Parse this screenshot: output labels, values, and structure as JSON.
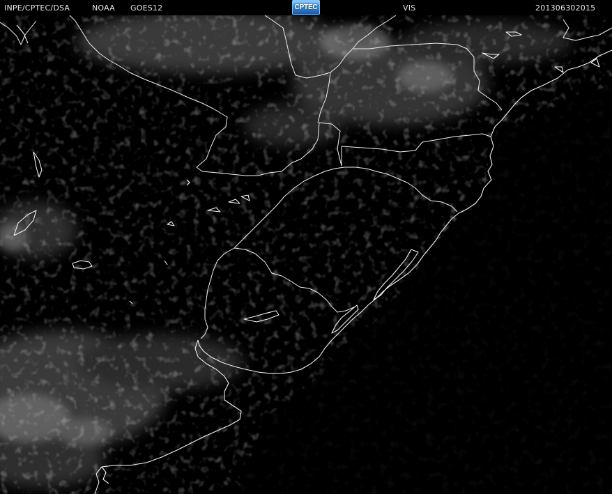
{
  "header": {
    "agency": "INPE/CPTEC/DSA",
    "source": "NOAA",
    "satellite": "GOES12",
    "logo_text": "CPTEC",
    "band": "VIS",
    "timestamp": "201306302015"
  },
  "colors": {
    "background": "#000000",
    "linework": "#f0f0f0",
    "clouds": "#8a8a8a",
    "logo": "#3c8fd6"
  }
}
